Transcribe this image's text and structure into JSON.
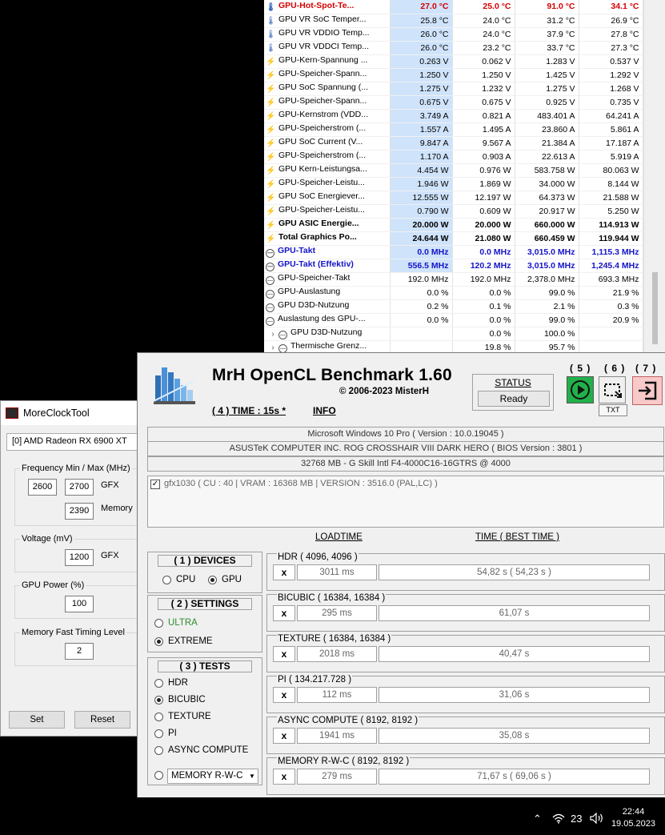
{
  "hwinfo": {
    "rows": [
      {
        "icon": "temp",
        "name": "GPU-Hot-Spot-Te...",
        "cur": "27.0 °C",
        "min": "25.0 °C",
        "max": "91.0 °C",
        "avg": "34.1 °C",
        "style": "red"
      },
      {
        "icon": "temp",
        "name": "GPU VR SoC Temper...",
        "cur": "25.8 °C",
        "min": "24.0 °C",
        "max": "31.2 °C",
        "avg": "26.9 °C",
        "style": ""
      },
      {
        "icon": "temp",
        "name": "GPU VR VDDIO Temp...",
        "cur": "26.0 °C",
        "min": "24.0 °C",
        "max": "37.9 °C",
        "avg": "27.8 °C",
        "style": ""
      },
      {
        "icon": "temp",
        "name": "GPU VR VDDCI Temp...",
        "cur": "26.0 °C",
        "min": "23.2 °C",
        "max": "33.7 °C",
        "avg": "27.3 °C",
        "style": ""
      },
      {
        "icon": "volt",
        "name": "GPU-Kern-Spannung ...",
        "cur": "0.263 V",
        "min": "0.062 V",
        "max": "1.283 V",
        "avg": "0.537 V",
        "style": ""
      },
      {
        "icon": "volt",
        "name": "GPU-Speicher-Spann...",
        "cur": "1.250 V",
        "min": "1.250 V",
        "max": "1.425 V",
        "avg": "1.292 V",
        "style": ""
      },
      {
        "icon": "volt",
        "name": "GPU SoC Spannung (...",
        "cur": "1.275 V",
        "min": "1.232 V",
        "max": "1.275 V",
        "avg": "1.268 V",
        "style": ""
      },
      {
        "icon": "volt",
        "name": "GPU-Speicher-Spann...",
        "cur": "0.675 V",
        "min": "0.675 V",
        "max": "0.925 V",
        "avg": "0.735 V",
        "style": ""
      },
      {
        "icon": "volt",
        "name": "GPU-Kernstrom (VDD...",
        "cur": "3.749 A",
        "min": "0.821 A",
        "max": "483.401 A",
        "avg": "64.241 A",
        "style": ""
      },
      {
        "icon": "volt",
        "name": "GPU-Speicherstrom (...",
        "cur": "1.557 A",
        "min": "1.495 A",
        "max": "23.860 A",
        "avg": "5.861 A",
        "style": ""
      },
      {
        "icon": "volt",
        "name": "GPU SoC Current (V...",
        "cur": "9.847 A",
        "min": "9.567 A",
        "max": "21.384 A",
        "avg": "17.187 A",
        "style": ""
      },
      {
        "icon": "volt",
        "name": "GPU-Speicherstrom (...",
        "cur": "1.170 A",
        "min": "0.903 A",
        "max": "22.613 A",
        "avg": "5.919 A",
        "style": ""
      },
      {
        "icon": "volt",
        "name": "GPU Kern-Leistungsa...",
        "cur": "4.454 W",
        "min": "0.976 W",
        "max": "583.758 W",
        "avg": "80.063 W",
        "style": ""
      },
      {
        "icon": "volt",
        "name": "GPU-Speicher-Leistu...",
        "cur": "1.946 W",
        "min": "1.869 W",
        "max": "34.000 W",
        "avg": "8.144 W",
        "style": ""
      },
      {
        "icon": "volt",
        "name": "GPU SoC Energiever...",
        "cur": "12.555 W",
        "min": "12.197 W",
        "max": "64.373 W",
        "avg": "21.588 W",
        "style": ""
      },
      {
        "icon": "volt",
        "name": "GPU-Speicher-Leistu...",
        "cur": "0.790 W",
        "min": "0.609 W",
        "max": "20.917 W",
        "avg": "5.250 W",
        "style": ""
      },
      {
        "icon": "volt",
        "name": "GPU ASIC Energie...",
        "cur": "20.000 W",
        "min": "20.000 W",
        "max": "660.000 W",
        "avg": "114.913 W",
        "style": "bold"
      },
      {
        "icon": "volt",
        "name": "Total Graphics Po...",
        "cur": "24.644 W",
        "min": "21.080 W",
        "max": "660.459 W",
        "avg": "119.944 W",
        "style": "bold"
      },
      {
        "icon": "clock",
        "name": "GPU-Takt",
        "cur": "0.0 MHz",
        "min": "0.0 MHz",
        "max": "3,015.0 MHz",
        "avg": "1,115.3 MHz",
        "style": "blue"
      },
      {
        "icon": "clock",
        "name": "GPU-Takt (Effektiv)",
        "cur": "556.5 MHz",
        "min": "120.2 MHz",
        "max": "3,015.0 MHz",
        "avg": "1,245.4 MHz",
        "style": "blue"
      },
      {
        "icon": "clock",
        "name": "GPU-Speicher-Takt",
        "cur": "192.0 MHz",
        "min": "192.0 MHz",
        "max": "2,378.0 MHz",
        "avg": "693.3 MHz",
        "style": "plain"
      },
      {
        "icon": "clock",
        "name": "GPU-Auslastung",
        "cur": "0.0 %",
        "min": "0.0 %",
        "max": "99.0 %",
        "avg": "21.9 %",
        "style": "plain"
      },
      {
        "icon": "clock",
        "name": "GPU D3D-Nutzung",
        "cur": "0.2 %",
        "min": "0.1 %",
        "max": "2.1 %",
        "avg": "0.3 %",
        "style": "plain"
      },
      {
        "icon": "clock",
        "name": "Auslastung des GPU-...",
        "cur": "0.0 %",
        "min": "0.0 %",
        "max": "99.0 %",
        "avg": "20.9 %",
        "style": "plain"
      },
      {
        "icon": "chevclock",
        "name": "GPU D3D-Nutzung",
        "cur": "",
        "min": "0.0 %",
        "max": "100.0 %",
        "avg": "",
        "style": "plain"
      },
      {
        "icon": "chevclock",
        "name": "Thermische Grenz...",
        "cur": "",
        "min": "19.8 %",
        "max": "95.7 %",
        "avg": "",
        "style": "plain"
      }
    ]
  },
  "moreclocktool": {
    "title": "MoreClockTool",
    "gpu": "[0] AMD Radeon RX 6900 XT",
    "freq_label": "Frequency Min / Max (MHz)",
    "gfx_min": "2600",
    "gfx_max": "2700",
    "gfx_label": "GFX",
    "memory_value": "2390",
    "memory_label": "Memory",
    "voltage_label": "Voltage (mV)",
    "voltage_value": "1200",
    "voltage_gfx_label": "GFX",
    "power_label": "GPU Power (%)",
    "power_value": "100",
    "timing_label": "Memory Fast Timing Level",
    "timing_value": "2",
    "set_label": "Set",
    "reset_label": "Reset"
  },
  "opencl": {
    "title": "MrH OpenCL Benchmark 1.60",
    "copyright": "©  2006-2023 MisterH",
    "time": "( 4 ) TIME : 15s *",
    "info": "INFO",
    "status_label": "STATUS",
    "status_value": "Ready",
    "btn5": "( 5 )",
    "btn6": "( 6 )",
    "btn7": "( 7 )",
    "txt_label": "TXT",
    "sysinfo": [
      "Microsoft Windows 10 Pro ( Version : 10.0.19045 )",
      "ASUSTeK COMPUTER INC. ROG CROSSHAIR VIII DARK HERO ( BIOS Version : 3801 )",
      "32768 MB - G Skill Intl F4-4000C16-16GTRS @ 4000"
    ],
    "device": "gfx1030 ( CU : 40 | VRAM : 16368 MB | VERSION : 3516.0 (PAL,LC) )",
    "col_loadtime": "LOADTIME",
    "col_time": "TIME ( BEST TIME )",
    "devices_title": "( 1 ) DEVICES",
    "cpu_label": "CPU",
    "gpu_label": "GPU",
    "selected_device": "GPU",
    "settings_title": "( 2 ) SETTINGS",
    "ultra_label": "ULTRA",
    "extreme_label": "EXTREME",
    "selected_setting": "EXTREME",
    "tests_title": "( 3 ) TESTS",
    "test_options": [
      "HDR",
      "BICUBIC",
      "TEXTURE",
      "PI",
      "ASYNC COMPUTE"
    ],
    "selected_test": "BICUBIC",
    "memory_select": "MEMORY R-W-C",
    "colors": {
      "ultra": "#2e8b2e",
      "play_button": "#22b04a",
      "exit_button": "#f7c9c9"
    },
    "tests": [
      {
        "name": "HDR ( 4096, 4096 )",
        "load": "3011 ms",
        "time": "54,82 s ( 54,23 s )"
      },
      {
        "name": "BICUBIC ( 16384, 16384 )",
        "load": "295 ms",
        "time": "61,07 s"
      },
      {
        "name": "TEXTURE ( 16384, 16384 )",
        "load": "2018 ms",
        "time": "40,47 s"
      },
      {
        "name": "PI ( 134.217.728 )",
        "load": "112 ms",
        "time": "31,06 s"
      },
      {
        "name": "ASYNC COMPUTE ( 8192, 8192 )",
        "load": "1941 ms",
        "time": "35,08 s"
      },
      {
        "name": "MEMORY R-W-C ( 8192, 8192 )",
        "load": "279 ms",
        "time": "71,67 s ( 69,06 s )"
      }
    ],
    "x_label": "x"
  },
  "taskbar": {
    "temperature": "23",
    "time": "22:44",
    "date": "19.05.2023"
  }
}
